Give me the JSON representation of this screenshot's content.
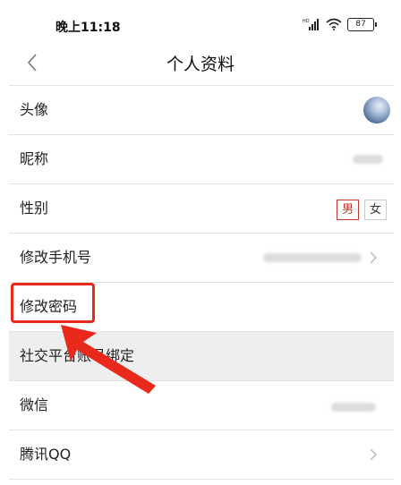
{
  "status_bar": {
    "time": "晚上11:18",
    "battery": "87",
    "signal_label": "HD"
  },
  "header": {
    "title": "个人资料"
  },
  "rows": [
    {
      "label": "头像"
    },
    {
      "label": "昵称"
    },
    {
      "label": "性别"
    },
    {
      "label": "修改手机号"
    },
    {
      "label": "修改密码"
    },
    {
      "label": "社交平台账号绑定"
    },
    {
      "label": "微信"
    },
    {
      "label": "腾讯QQ"
    }
  ],
  "gender": {
    "options": [
      "男",
      "女"
    ],
    "selected": "男"
  },
  "colors": {
    "highlight": "#e8291c",
    "selected_gender": "#c0392b"
  }
}
